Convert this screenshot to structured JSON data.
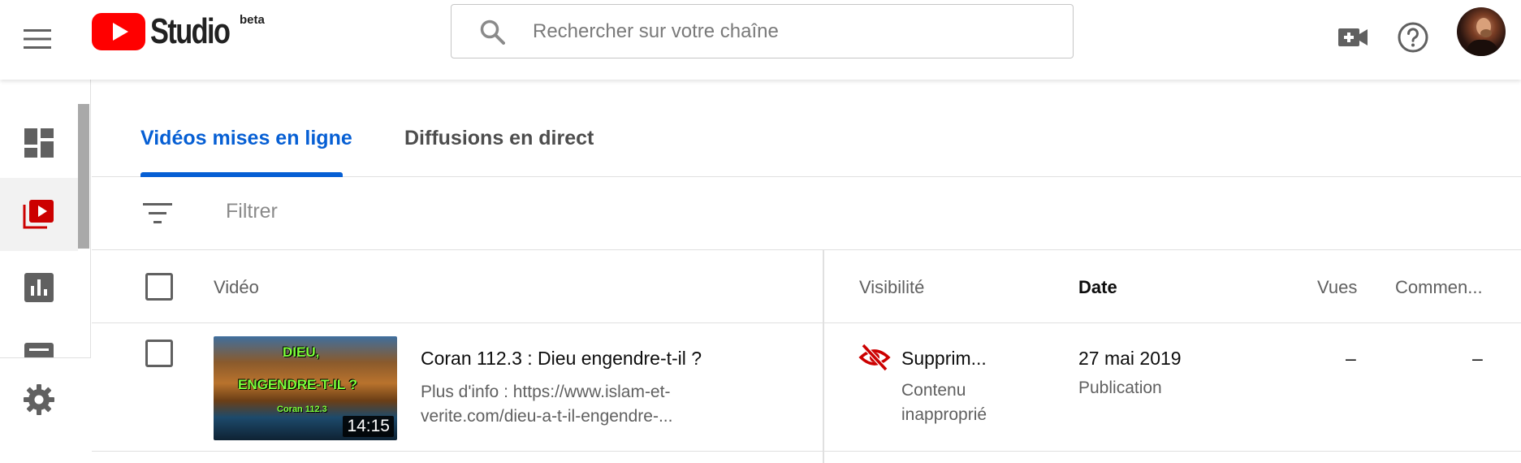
{
  "header": {
    "logo_text": "Studio",
    "logo_badge": "beta",
    "search_placeholder": "Rechercher sur votre chaîne"
  },
  "tabs": [
    {
      "label": "Vidéos mises en ligne",
      "active": true
    },
    {
      "label": "Diffusions en direct",
      "active": false
    }
  ],
  "filter": {
    "placeholder": "Filtrer"
  },
  "table": {
    "columns": {
      "video": "Vidéo",
      "visibility": "Visibilité",
      "date": "Date",
      "views": "Vues",
      "comments": "Commen..."
    },
    "rows": [
      {
        "thumbnail_text": [
          "DIEU,",
          "ENGENDRE-T-IL ?",
          "Coran 112.3"
        ],
        "duration": "14:15",
        "title": "Coran 112.3 : Dieu engendre-t-il ?",
        "description": "Plus d'info : https://www.islam-et-verite.com/dieu-a-t-il-engendre-...",
        "visibility": "Supprim...",
        "visibility_note": "Contenu inapproprié",
        "date": "27 mai 2019",
        "date_note": "Publication",
        "views": "–",
        "comments": "–"
      }
    ]
  },
  "colors": {
    "accent": "#065fd4",
    "youtube_red": "#ff0000",
    "removed_red": "#cc0000"
  }
}
